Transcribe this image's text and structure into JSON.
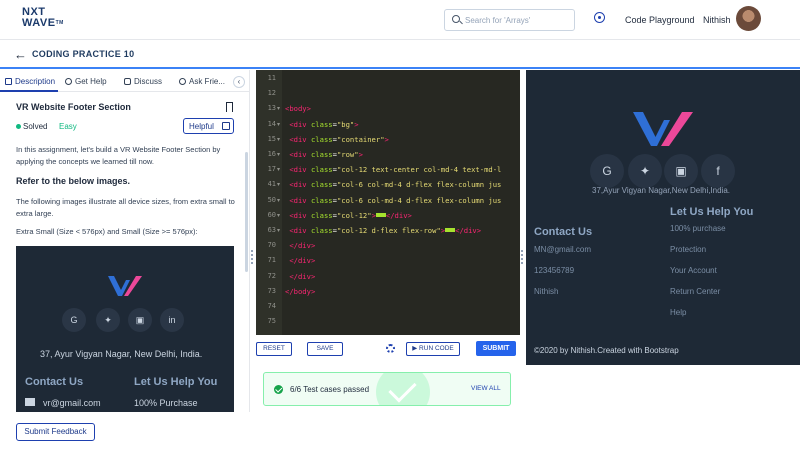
{
  "header": {
    "logo_top": "NXT",
    "logo_bottom": "WAVE",
    "logo_tm": "TM",
    "search_placeholder": "Search for 'Arrays'",
    "playground": "Code Playground",
    "username": "Nithish"
  },
  "subheader": {
    "title": "CODING PRACTICE 10"
  },
  "tabs": [
    "Description",
    "Get Help",
    "Discuss",
    "Ask Frie..."
  ],
  "question": {
    "title": "VR Website Footer Section",
    "status": "Solved",
    "difficulty": "Easy",
    "helpful": "Helpful",
    "intro": "In this assignment, let's build a VR Website Footer Section by applying the concepts we learned till now.",
    "refer_heading": "Refer to the below images.",
    "devices_text": "The following images illustrate all device sizes, from extra small to extra large.",
    "sizes_text": "Extra Small (Size < 576px) and Small (Size >= 576px):"
  },
  "sample_image": {
    "address": "37, Ayur Vigyan Nagar, New Delhi, India.",
    "contact_heading": "Contact Us",
    "help_heading": "Let Us Help You",
    "email": "vr@gmail.com",
    "purchase": "100% Purchase"
  },
  "submit_feedback": "Submit Feedback",
  "editor": {
    "lines": [
      {
        "n": "11",
        "html": ""
      },
      {
        "n": "12",
        "html": ""
      },
      {
        "n": "13",
        "fold": true,
        "html": "<span class=\"tg\">&lt;body&gt;</span>"
      },
      {
        "n": "14",
        "fold": true,
        "html": " <span class=\"tg\">&lt;div</span> <span class=\"at\">class</span>=<span class=\"st\">\"bg\"</span><span class=\"tg\">&gt;</span>"
      },
      {
        "n": "15",
        "fold": true,
        "html": " <span class=\"tg\">&lt;div</span> <span class=\"at\">class</span>=<span class=\"st\">\"container\"</span><span class=\"tg\">&gt;</span>"
      },
      {
        "n": "16",
        "fold": true,
        "html": " <span class=\"tg\">&lt;div</span> <span class=\"at\">class</span>=<span class=\"st\">\"row\"</span><span class=\"tg\">&gt;</span>"
      },
      {
        "n": "17",
        "fold": true,
        "html": " <span class=\"tg\">&lt;div</span> <span class=\"at\">class</span>=<span class=\"st\">\"col-12 text-center col-md-4 text-md-l</span>"
      },
      {
        "n": "41",
        "fold": true,
        "html": " <span class=\"tg\">&lt;div</span> <span class=\"at\">class</span>=<span class=\"st\">\"col-6 col-md-4 d-flex flex-column jus</span>"
      },
      {
        "n": "50",
        "fold": true,
        "html": " <span class=\"tg\">&lt;div</span> <span class=\"at\">class</span>=<span class=\"st\">\"col-6 col-md-4 d-flex flex-column jus</span>"
      },
      {
        "n": "60",
        "fold": true,
        "html": " <span class=\"tg\">&lt;div</span> <span class=\"at\">class</span>=<span class=\"st\">\"col-12\"</span><span class=\"tg\">&gt;</span><span class=\"blk\"></span><span class=\"tg\">&lt;/div&gt;</span>"
      },
      {
        "n": "63",
        "fold": true,
        "html": " <span class=\"tg\">&lt;div</span> <span class=\"at\">class</span>=<span class=\"st\">\"col-12 d-flex flex-row\"</span><span class=\"tg\">&gt;</span><span class=\"blk\"></span><span class=\"tg\">&lt;/div&gt;</span>"
      },
      {
        "n": "70",
        "html": " <span class=\"tg\">&lt;/div&gt;</span>"
      },
      {
        "n": "71",
        "html": " <span class=\"tg\">&lt;/div&gt;</span>"
      },
      {
        "n": "72",
        "html": " <span class=\"tg\">&lt;/div&gt;</span>"
      },
      {
        "n": "73",
        "html": "<span class=\"tg\">&lt;/body&gt;</span>"
      },
      {
        "n": "74",
        "html": ""
      },
      {
        "n": "75",
        "html": ""
      }
    ]
  },
  "controls": {
    "reset": "RESET",
    "save": "SAVE",
    "run_code": "▶ RUN CODE",
    "submit": "SUBMIT"
  },
  "results": {
    "text": "6/6 Test cases passed",
    "view_all": "VIEW ALL"
  },
  "preview": {
    "address": "37,Ayur Vigyan Nagar,New Delhi,India.",
    "contact_heading": "Contact Us",
    "contact_items": [
      "MN@gmail.com",
      "123456789",
      "Nithish"
    ],
    "help_heading": "Let Us Help You",
    "help_items": [
      "100% purchase",
      "Protection",
      "Your Account",
      "Return Center",
      "Help"
    ],
    "copyright": "©2020 by Nithish.Created with Bootstrap"
  },
  "colors": {
    "accent": "#2563eb",
    "logo_blue": "#2f6fd6",
    "logo_pink": "#ec4899",
    "footer_bg": "#1e2936"
  }
}
